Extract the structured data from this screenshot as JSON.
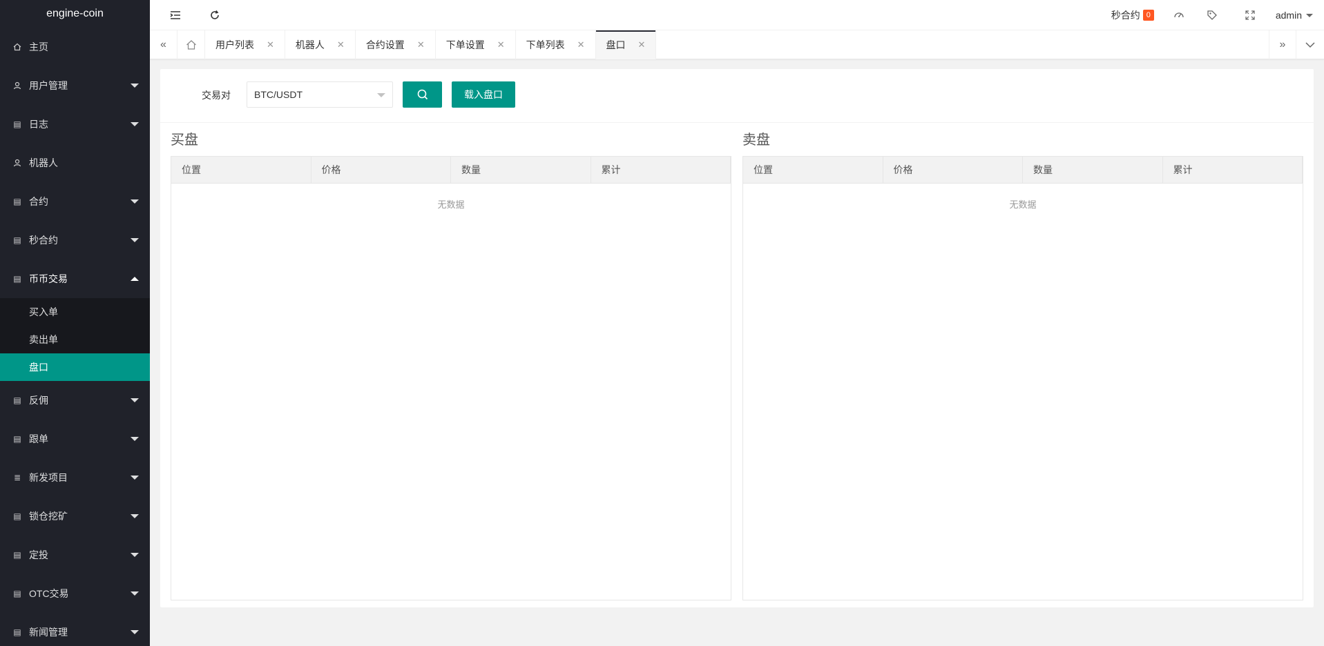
{
  "app": {
    "title": "engine-coin"
  },
  "sidebar": {
    "items": [
      {
        "label": "主页",
        "icon": "home-icon",
        "arrow": "none"
      },
      {
        "label": "用户管理",
        "icon": "user-icon",
        "arrow": "down"
      },
      {
        "label": "日志",
        "icon": "file-icon",
        "arrow": "down"
      },
      {
        "label": "机器人",
        "icon": "user-icon",
        "arrow": "none"
      },
      {
        "label": "合约",
        "icon": "file-icon",
        "arrow": "down"
      },
      {
        "label": "秒合约",
        "icon": "file-icon",
        "arrow": "down"
      },
      {
        "label": "币币交易",
        "icon": "file-icon",
        "arrow": "up"
      },
      {
        "label": "反佣",
        "icon": "file-icon",
        "arrow": "down"
      },
      {
        "label": "跟单",
        "icon": "file-icon",
        "arrow": "down"
      },
      {
        "label": "新发项目",
        "icon": "list-icon",
        "arrow": "down"
      },
      {
        "label": "锁仓挖矿",
        "icon": "file-icon",
        "arrow": "down"
      },
      {
        "label": "定投",
        "icon": "file-icon",
        "arrow": "down"
      },
      {
        "label": "OTC交易",
        "icon": "file-icon",
        "arrow": "down"
      },
      {
        "label": "新闻管理",
        "icon": "file-icon",
        "arrow": "down"
      }
    ],
    "subitems": [
      {
        "label": "买入单"
      },
      {
        "label": "卖出单"
      },
      {
        "label": "盘口"
      }
    ]
  },
  "header": {
    "seconds_contract_label": "秒合约",
    "seconds_contract_count": "0",
    "user": "admin"
  },
  "tabs": [
    {
      "label": "用户列表"
    },
    {
      "label": "机器人"
    },
    {
      "label": "合约设置"
    },
    {
      "label": "下单设置"
    },
    {
      "label": "下单列表"
    },
    {
      "label": "盘口"
    }
  ],
  "toolbar": {
    "pair_label": "交易对",
    "pair_value": "BTC/USDT",
    "load_label": "载入盘口"
  },
  "buy": {
    "title": "买盘",
    "columns": [
      "位置",
      "价格",
      "数量",
      "累计"
    ],
    "empty": "无数据"
  },
  "sell": {
    "title": "卖盘",
    "columns": [
      "位置",
      "价格",
      "数量",
      "累计"
    ],
    "empty": "无数据"
  },
  "colors": {
    "accent": "#009688",
    "sidebar": "#20222a",
    "badge": "#ff5722"
  }
}
